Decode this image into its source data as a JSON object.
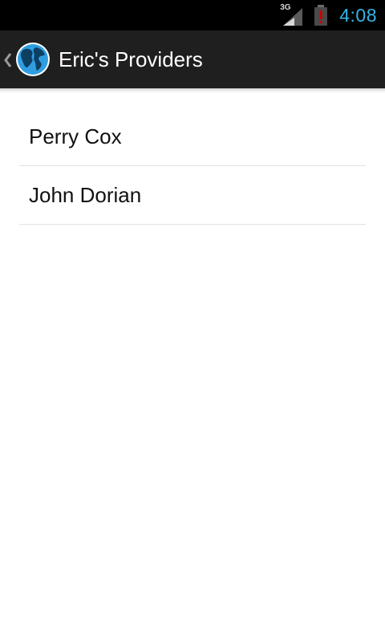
{
  "status_bar": {
    "network_type": "3G",
    "time": "4:08",
    "icons": [
      "signal-icon",
      "battery-alert-icon"
    ],
    "colors": {
      "clock": "#33b5e5",
      "battery_alert": "#cc0000"
    }
  },
  "action_bar": {
    "up_icon": "chevron-left-icon",
    "app_icon": "globe-icon",
    "title": "Eric's Providers"
  },
  "providers": [
    {
      "name": "Perry Cox"
    },
    {
      "name": "John Dorian"
    }
  ]
}
